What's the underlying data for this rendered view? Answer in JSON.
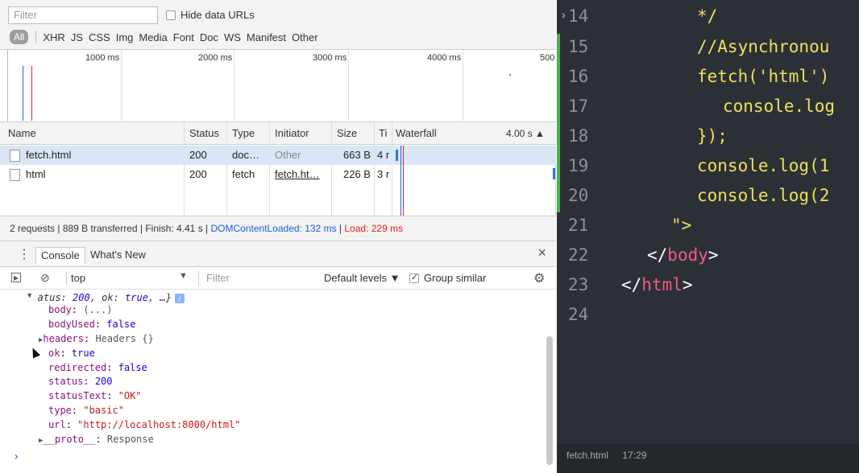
{
  "network": {
    "filter_placeholder": "Filter",
    "hide_data_urls": "Hide data URLs",
    "type_filters": [
      "All",
      "XHR",
      "JS",
      "CSS",
      "Img",
      "Media",
      "Font",
      "Doc",
      "WS",
      "Manifest",
      "Other"
    ],
    "ticks": [
      "1000 ms",
      "2000 ms",
      "3000 ms",
      "4000 ms",
      "500"
    ],
    "columns": [
      "Name",
      "Status",
      "Type",
      "Initiator",
      "Size",
      "Ti",
      "Waterfall",
      "4.00 s ▲"
    ],
    "rows": [
      {
        "name": "fetch.html",
        "status": "200",
        "type": "doc…",
        "initiator": "Other",
        "size": "663 B",
        "time": "4 r"
      },
      {
        "name": "html",
        "status": "200",
        "type": "fetch",
        "initiator": "fetch.ht…",
        "size": "226 B",
        "time": "3 r"
      }
    ],
    "summary": {
      "main": "2 requests | 889 B transferred | Finish: 4.41 s | ",
      "dcl": "DOMContentLoaded: 132 ms",
      "sep": " | ",
      "load": "Load: 229 ms"
    }
  },
  "drawer": {
    "kebab": "⋮",
    "tabs": [
      "Console",
      "What's New"
    ],
    "close": "×"
  },
  "console_toolbar": {
    "context": "top",
    "filter_placeholder": "Filter",
    "levels": "Default levels ▼",
    "group_similar": "Group similar"
  },
  "console_output": {
    "header_pre": "atus: ",
    "header_status": "200",
    "header_mid": ", ok: ",
    "header_ok": "true",
    "header_post": ", …}",
    "info_badge": "i",
    "lines": [
      {
        "key": "body",
        "val": "(...)",
        "kind": "dim",
        "arrow": ""
      },
      {
        "key": "bodyUsed",
        "val": "false",
        "kind": "num",
        "arrow": ""
      },
      {
        "key": "headers",
        "val": "Headers {}",
        "kind": "dim",
        "arrow": "▶"
      },
      {
        "key": "ok",
        "val": "true",
        "kind": "num",
        "arrow": ""
      },
      {
        "key": "redirected",
        "val": "false",
        "kind": "num",
        "arrow": ""
      },
      {
        "key": "status",
        "val": "200",
        "kind": "num",
        "arrow": ""
      },
      {
        "key": "statusText",
        "val": "\"OK\"",
        "kind": "str",
        "arrow": ""
      },
      {
        "key": "type",
        "val": "\"basic\"",
        "kind": "str",
        "arrow": ""
      },
      {
        "key": "url",
        "val": "\"http://localhost:8000/html\"",
        "kind": "str",
        "arrow": ""
      },
      {
        "key": "__proto__",
        "val": "Response",
        "kind": "dim",
        "arrow": "▶"
      }
    ],
    "prompt": "›"
  },
  "editor": {
    "lines": [
      {
        "no": "14",
        "code": "*/"
      },
      {
        "no": "15",
        "code": "//Asynchronou"
      },
      {
        "no": "16",
        "code": "fetch('html')"
      },
      {
        "no": "17",
        "code": "console.log"
      },
      {
        "no": "18",
        "code": "});"
      },
      {
        "no": "19",
        "code": "console.log(1"
      },
      {
        "no": "20",
        "code": "console.log(2"
      },
      {
        "no": "21",
        "code": "\">"
      },
      {
        "no": "22",
        "code_open": "</",
        "code_tag": "body",
        "code_close": ">"
      },
      {
        "no": "23",
        "code_open": "</",
        "code_tag": "html",
        "code_close": ">"
      },
      {
        "no": "24",
        "code": ""
      }
    ],
    "status_file": "fetch.html",
    "status_pos": "17:29"
  },
  "colors": {
    "editor_bg": "#2b3036",
    "keyword_yellow": "#f1e05a",
    "tag_pink": "#f35b87",
    "gutter_green": "#4caf50",
    "dcl_blue": "#1a5ed8",
    "load_red": "#dd2222"
  }
}
